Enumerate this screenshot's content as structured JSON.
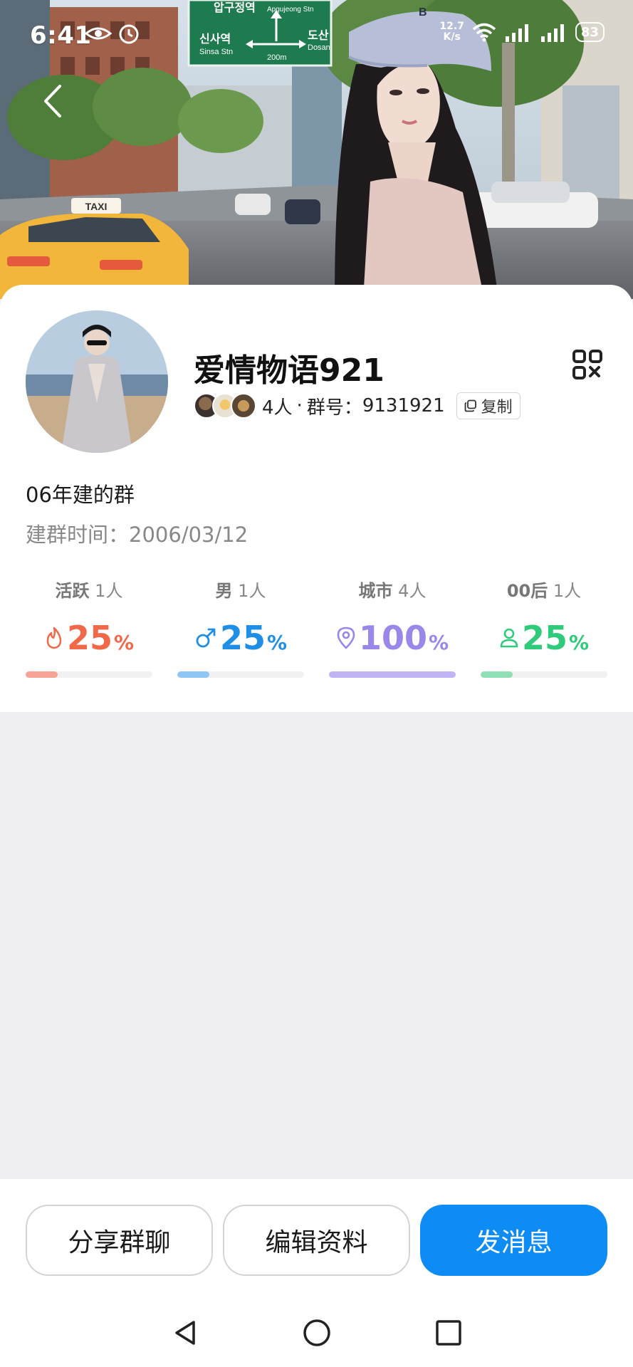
{
  "status_bar": {
    "time": "6:41",
    "net_speed_value": "12.7",
    "net_speed_unit": "K/s",
    "battery": "83"
  },
  "hero": {
    "sign_top": "압구정역",
    "sign_top_small": "Apgujeong Stn",
    "sign_left": "신사역",
    "sign_left_small": "Sinsa Stn",
    "sign_right": "도산",
    "sign_right_small": "Dosan",
    "sign_distance": "200m",
    "taxi_label": "TAXI",
    "cap_letter": "B"
  },
  "group": {
    "name": "爱情物语921",
    "member_count": "4人",
    "separator": "·",
    "id_label": "群号：",
    "id_value": "9131921",
    "copy_label": "复制",
    "description": "06年建的群",
    "created_label": "建群时间：",
    "created_value": "2006/03/12"
  },
  "stats": [
    {
      "label": "活跃",
      "count": "1人",
      "value": "25",
      "unit": "%",
      "fraction": 0.25,
      "color": "#f06a4a",
      "bar_color": "#f7a496",
      "icon": "flame-icon"
    },
    {
      "label": "男",
      "count": "1人",
      "value": "25",
      "unit": "%",
      "fraction": 0.25,
      "color": "#1f8ee6",
      "bar_color": "#90c6f5",
      "icon": "male-icon"
    },
    {
      "label": "城市",
      "count": "4人",
      "value": "100",
      "unit": "%",
      "fraction": 1.0,
      "color": "#9b86ea",
      "bar_color": "#c1b3f4",
      "icon": "location-pin-icon"
    },
    {
      "label": "00后",
      "count": "1人",
      "value": "25",
      "unit": "%",
      "fraction": 0.25,
      "color": "#2fca7a",
      "bar_color": "#8fe0b6",
      "icon": "person-icon"
    }
  ],
  "actions": {
    "share": "分享群聊",
    "edit": "编辑资料",
    "send": "发消息"
  },
  "colors": {
    "primary": "#0d8cf5",
    "page_bg": "#efeff4"
  }
}
